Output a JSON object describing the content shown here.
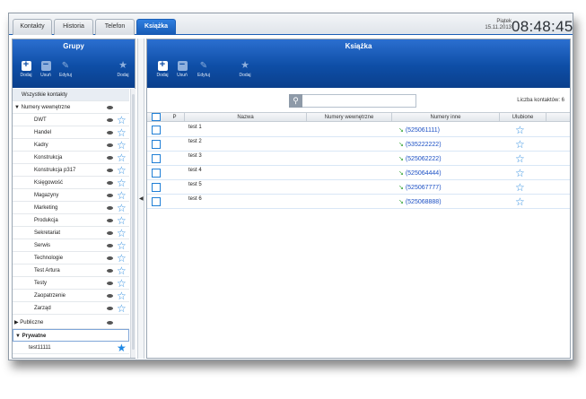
{
  "tabs": [
    {
      "label": "Kontakty",
      "active": false
    },
    {
      "label": "Historia",
      "active": false
    },
    {
      "label": "Telefon",
      "active": false
    },
    {
      "label": "Książka",
      "active": true
    }
  ],
  "clock": {
    "day": "Piątek",
    "date": "15.11.2013",
    "time": "08:48:45"
  },
  "left_panel": {
    "title": "Grupy",
    "toolbar": [
      {
        "label": "Dodaj",
        "icon": "plus-square-icon"
      },
      {
        "label": "Usuń",
        "icon": "minus-square-icon"
      },
      {
        "label": "Edytuj",
        "icon": "edit-icon"
      },
      {
        "label": "Dodaj",
        "icon": "star-icon"
      }
    ],
    "all_contacts": "Wszystkie kontakty",
    "internal_category": "Numery wewnętrzne",
    "internal_groups": [
      "DWT",
      "Handel",
      "Kadry",
      "Konstrukcja",
      "Konstrukcja p317",
      "Księgowość",
      "Magazyny",
      "Marketing",
      "Produkcja",
      "Sekretariat",
      "Serwis",
      "Technologie",
      "Test Artura",
      "Testy",
      "Zaopatrzenie",
      "Zarząd"
    ],
    "public_category": "Publiczne",
    "private_category": "Prywatne",
    "private_groups": [
      "test11111"
    ]
  },
  "right_panel": {
    "title": "Książka",
    "toolbar": [
      {
        "label": "Dodaj",
        "icon": "plus-square-icon"
      },
      {
        "label": "Usuń",
        "icon": "minus-square-icon"
      },
      {
        "label": "Edytuj",
        "icon": "edit-icon"
      },
      {
        "label": "Dodaj",
        "icon": "star-icon"
      }
    ],
    "search_placeholder": "",
    "contact_count": "Liczba kontaktów: 6",
    "columns": [
      "P",
      "Nazwa",
      "Numery wewnętrzne",
      "Numery inne",
      "Ulubione"
    ],
    "rows": [
      {
        "name": "test 1",
        "internal": "",
        "other": "(525061111)"
      },
      {
        "name": "test 2",
        "internal": "",
        "other": "(535222222)"
      },
      {
        "name": "test 3",
        "internal": "",
        "other": "(525062222)"
      },
      {
        "name": "test 4",
        "internal": "",
        "other": "(525064444)"
      },
      {
        "name": "test 5",
        "internal": "",
        "other": "(525067777)"
      },
      {
        "name": "test 6",
        "internal": "",
        "other": "(525068888)"
      }
    ]
  },
  "colors": {
    "accent": "#1659b3",
    "header_blue": "#0e4ea6",
    "star": "#2e8de0",
    "phone_green": "#2aa02a",
    "phone_link": "#1a4fc4"
  }
}
